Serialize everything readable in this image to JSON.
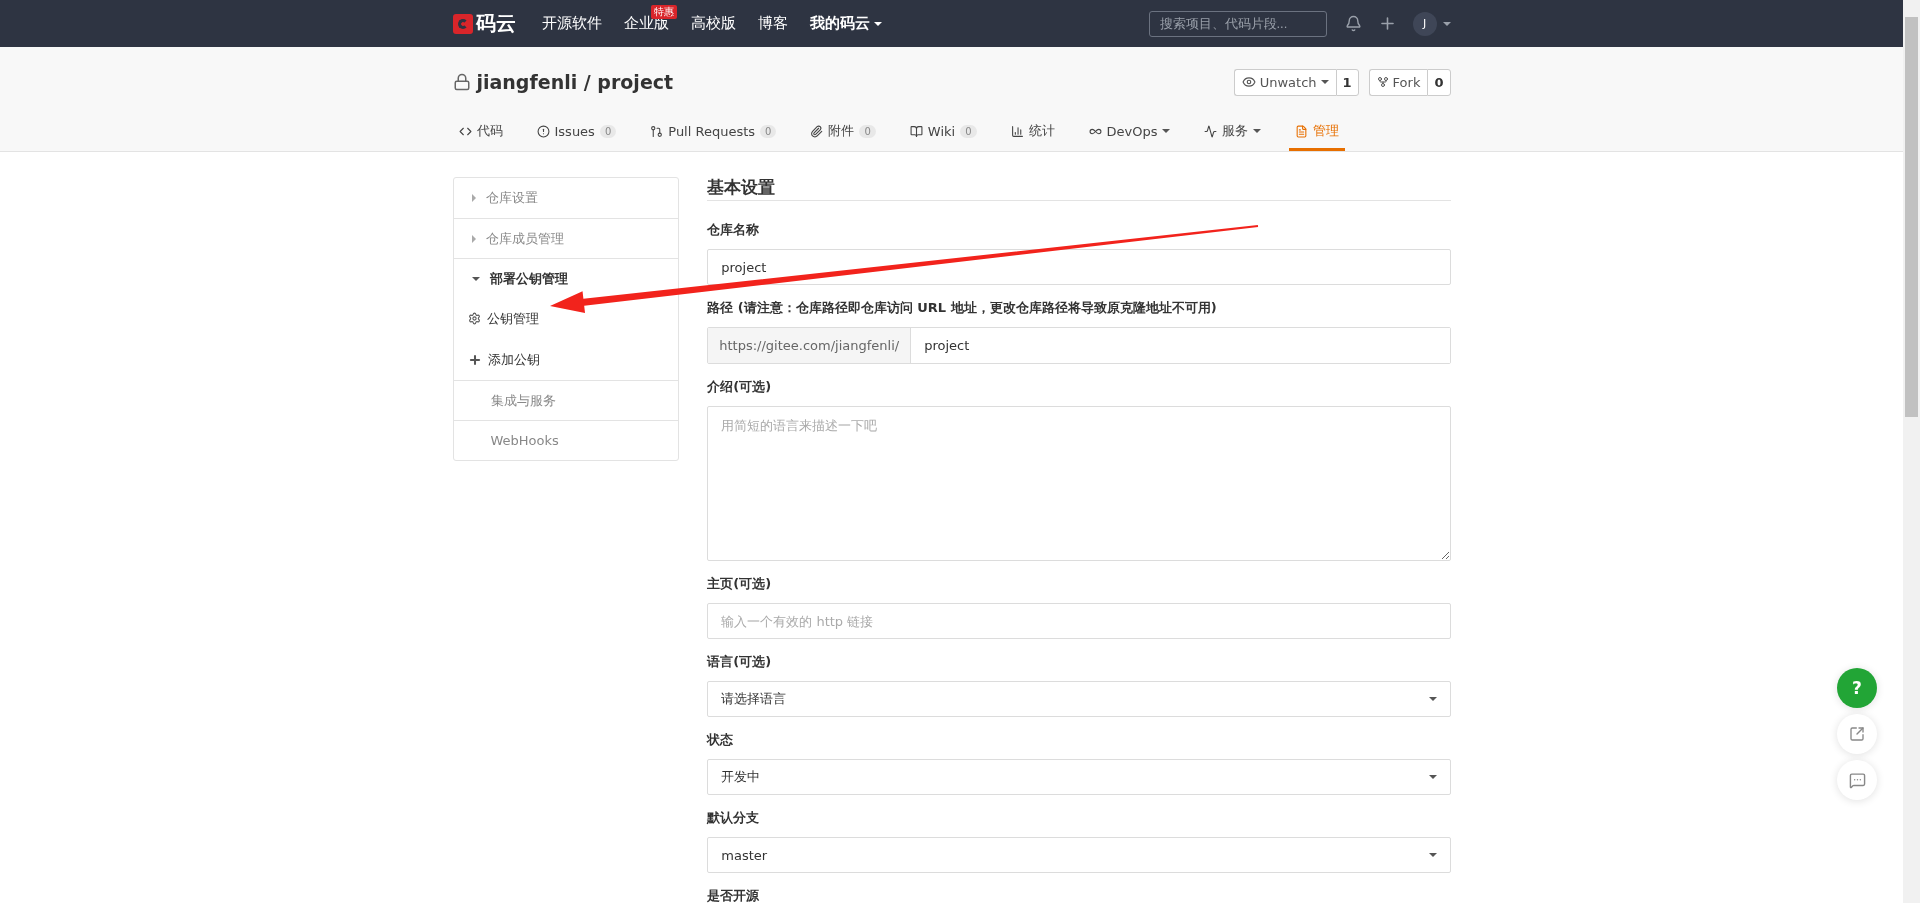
{
  "nav": {
    "logo": "码云",
    "items": [
      {
        "label": "开源软件",
        "dropdown": false
      },
      {
        "label": "企业版",
        "dropdown": false,
        "badge": "特惠"
      },
      {
        "label": "高校版",
        "dropdown": false
      },
      {
        "label": "博客",
        "dropdown": false
      },
      {
        "label": "我的码云",
        "dropdown": true
      }
    ],
    "search": {
      "placeholder": "搜索项目、代码片段..."
    },
    "avatar": "J"
  },
  "repo": {
    "title": "jiangfenli / project",
    "actions": [
      {
        "kind": "watch",
        "label": "Unwatch",
        "count": "1",
        "dropdown": true
      },
      {
        "kind": "fork",
        "label": "Fork",
        "count": "0",
        "dropdown": false
      }
    ]
  },
  "tabs": [
    {
      "kind": "code",
      "label": "代码",
      "selected": false,
      "dropdown": false
    },
    {
      "kind": "issues",
      "label": "Issues",
      "count": "0",
      "selected": false,
      "dropdown": false
    },
    {
      "kind": "pulls",
      "label": "Pull Requests",
      "count": "0",
      "selected": false,
      "dropdown": false
    },
    {
      "kind": "attachments",
      "label": "附件",
      "count": "0",
      "selected": false,
      "dropdown": false
    },
    {
      "kind": "wiki",
      "label": "Wiki",
      "count": "0",
      "selected": false,
      "dropdown": false
    },
    {
      "kind": "stats",
      "label": "统计",
      "selected": false,
      "dropdown": false
    },
    {
      "kind": "devops",
      "label": "DevOps",
      "selected": false,
      "dropdown": true
    },
    {
      "kind": "services",
      "label": "服务",
      "selected": false,
      "dropdown": true
    },
    {
      "kind": "manage",
      "label": "管理",
      "selected": true,
      "dropdown": false
    }
  ],
  "sidebar": {
    "items": [
      {
        "kind": "group",
        "label": "仓库设置",
        "expanded": false
      },
      {
        "kind": "group",
        "label": "仓库成员管理",
        "expanded": false
      },
      {
        "kind": "group",
        "label": "部署公钥管理",
        "expanded": true,
        "children": [
          {
            "kind": "manage",
            "label": "公钥管理"
          },
          {
            "kind": "add",
            "label": "添加公钥"
          }
        ]
      },
      {
        "kind": "link",
        "label": "集成与服务"
      },
      {
        "kind": "link",
        "label": "WebHooks"
      }
    ]
  },
  "form": {
    "title": "基本设置",
    "fields": [
      {
        "kind": "text",
        "label": "仓库名称",
        "value": "project"
      },
      {
        "kind": "prefixed",
        "label": "路径 (请注意：仓库路径即仓库访问 URL 地址，更改仓库路径将导致原克隆地址不可用)",
        "prefix": "https://gitee.com/jiangfenli/",
        "value": "project"
      },
      {
        "kind": "textarea",
        "label": "介绍(可选)",
        "placeholder": "用简短的语言来描述一下吧"
      },
      {
        "kind": "text",
        "label": "主页(可选)",
        "placeholder": "输入一个有效的 http 链接"
      },
      {
        "kind": "select",
        "label": "语言(可选)",
        "value": "请选择语言"
      },
      {
        "kind": "select",
        "label": "状态",
        "value": "开发中"
      },
      {
        "kind": "select",
        "label": "默认分支",
        "value": "master"
      },
      {
        "kind": "label",
        "label": "是否开源"
      }
    ]
  },
  "floating": {
    "help": "?"
  }
}
